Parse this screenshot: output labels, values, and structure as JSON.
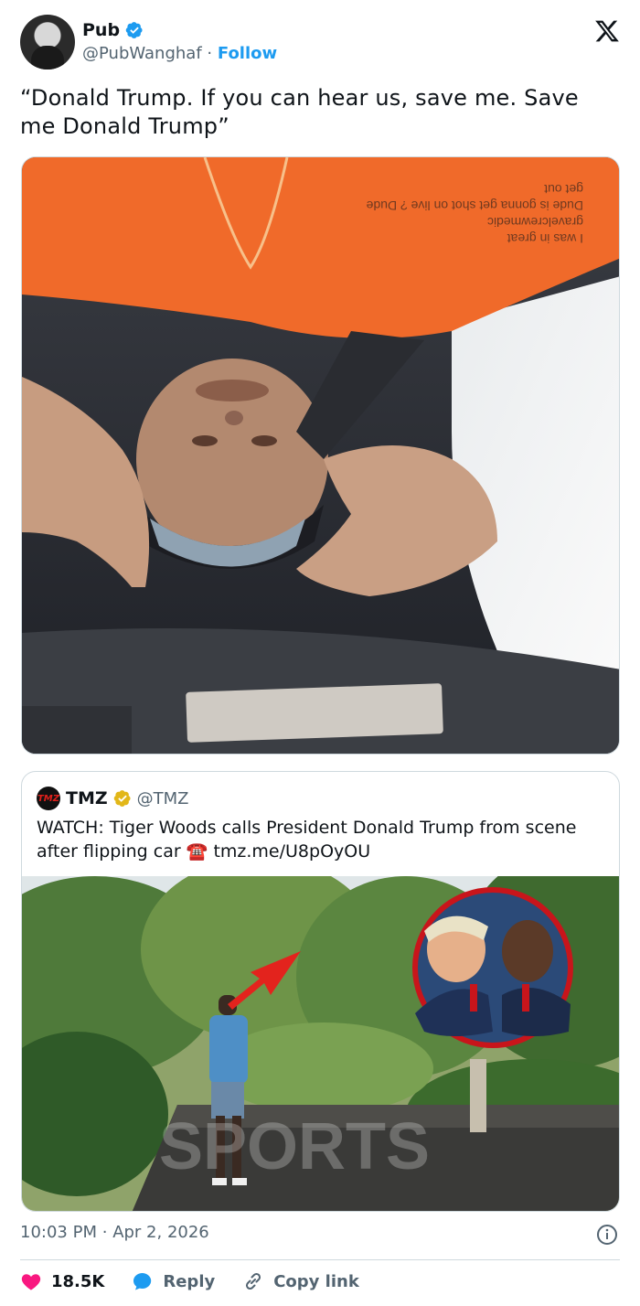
{
  "user": {
    "name": "Pub",
    "handle": "@PubWanghaf",
    "separator": "·",
    "follow_label": "Follow"
  },
  "tweet": {
    "text": "“Donald Trump. If you can hear us, save me. Save me Donald Trump”",
    "media_caption_lines": [
      "get out",
      "Dude is gonna get shot on live ? Dude",
      "gravelcrewmedic",
      "I was in great"
    ]
  },
  "quote": {
    "name": "TMZ",
    "handle": "@TMZ",
    "logo_text": "TMZ",
    "text": "WATCH: Tiger Woods calls President Donald Trump from scene after flipping car",
    "phone_emoji": "☎️",
    "link": "tmz.me/U8pOyOU",
    "watermark": "SPORTS"
  },
  "footer": {
    "time": "10:03 PM",
    "separator": "·",
    "date": "Apr 2, 2026"
  },
  "actions": {
    "likes": "18.5K",
    "reply_label": "Reply",
    "copy_label": "Copy link"
  },
  "colors": {
    "brand": "#1d9bf0",
    "like": "#f91880",
    "text": "#0f1419",
    "muted": "#536471",
    "tmz_red": "#e0201b"
  },
  "icons": [
    "x-logo-icon",
    "verified-badge-icon",
    "gold-verified-badge-icon",
    "info-icon",
    "heart-icon",
    "reply-bubble-icon",
    "link-icon"
  ]
}
